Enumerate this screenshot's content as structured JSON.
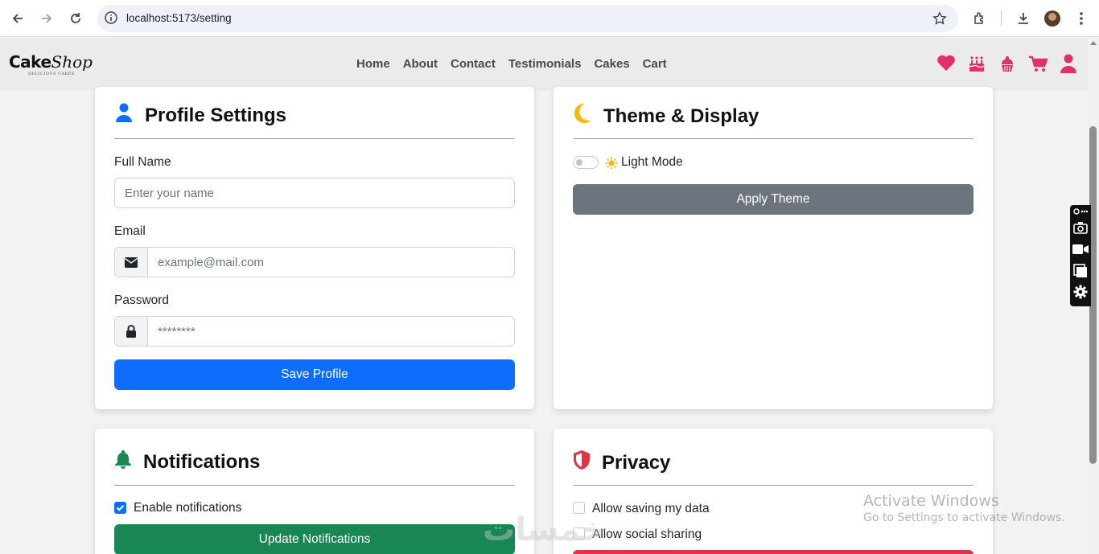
{
  "browser": {
    "url": "localhost:5173/setting",
    "icons": [
      "back-icon",
      "forward-icon",
      "reload-icon",
      "site-info-icon",
      "bookmark-star-icon",
      "extensions-icon",
      "download-icon",
      "profile-avatar"
    ]
  },
  "site": {
    "logo_cake": "Cake",
    "logo_shop": "Shop",
    "logo_tagline": "DELICIOUS CAKES",
    "nav": [
      "Home",
      "About",
      "Contact",
      "Testimonials",
      "Cakes",
      "Cart"
    ],
    "header_icons": [
      "heart-icon",
      "birthday-cake-icon",
      "cupcake-icon",
      "cart-icon",
      "user-icon"
    ],
    "accent_color": "#e0306e"
  },
  "profile": {
    "title": "Profile Settings",
    "name_label": "Full Name",
    "name_placeholder": "Enter your name",
    "email_label": "Email",
    "email_placeholder": "example@mail.com",
    "password_label": "Password",
    "password_placeholder": "********",
    "save_label": "Save Profile",
    "button_color": "#0d6efd"
  },
  "theme": {
    "title": "Theme & Display",
    "mode_label": "Light Mode",
    "dark_mode_enabled": false,
    "apply_label": "Apply Theme",
    "button_color": "#6c757d"
  },
  "notifications": {
    "title": "Notifications",
    "enable_label": "Enable notifications",
    "enabled": true,
    "update_label": "Update Notifications",
    "button_color": "#198754"
  },
  "privacy": {
    "title": "Privacy",
    "save_data_label": "Allow saving my data",
    "social_label": "Allow social sharing",
    "save_data_checked": false,
    "social_checked": false,
    "button_color": "#dc3545"
  },
  "overlay": {
    "activate_title": "Activate Windows",
    "activate_sub": "Go to Settings to activate Windows.",
    "watermark": "خمسات"
  }
}
